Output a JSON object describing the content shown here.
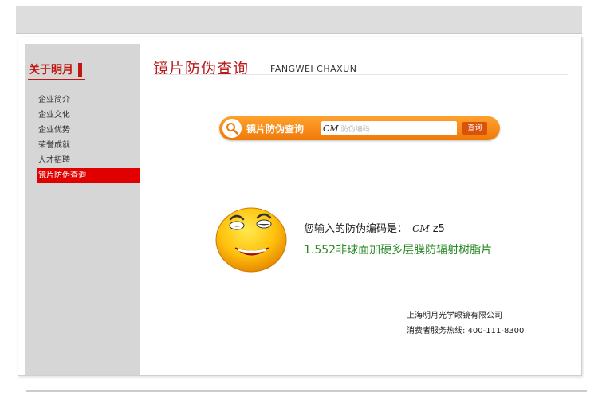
{
  "sidebar": {
    "title": "关于明月",
    "items": [
      {
        "label": "企业简介"
      },
      {
        "label": "企业文化"
      },
      {
        "label": "企业优势"
      },
      {
        "label": "荣誉成就"
      },
      {
        "label": "人才招聘"
      },
      {
        "label": "镜片防伪查询",
        "active": true
      }
    ]
  },
  "main": {
    "title": "镜片防伪查询",
    "subtitle": "FANGWEI CHAXUN"
  },
  "search": {
    "icon": "magnifier-icon",
    "label": "镜片防伪查询",
    "logo_text": "CM",
    "placeholder": "防伪编码",
    "button_label": "查询"
  },
  "result": {
    "prompt": "您输入的防伪编码是：",
    "code_logo": "CM",
    "code": "z5",
    "product": "1.552非球面加硬多层膜防辐射树脂片"
  },
  "footer": {
    "company": "上海明月光学眼镜有限公司",
    "hotline": "消费者服务热线: 400-111-8300"
  },
  "colors": {
    "accent_red": "#e00000",
    "title_red": "#b71c1c",
    "search_orange": "#f07a09",
    "product_green": "#2a8a25"
  }
}
